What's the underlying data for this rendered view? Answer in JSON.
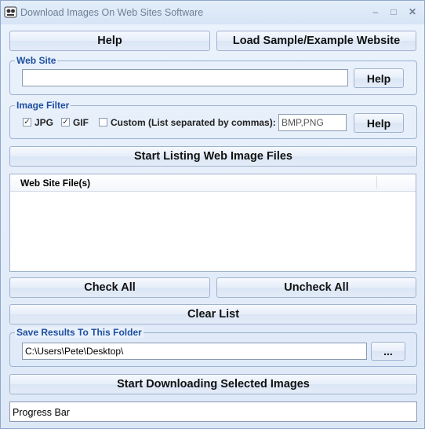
{
  "window": {
    "title": "Download Images On Web Sites Software",
    "controls": {
      "minimize": "–",
      "maximize": "□",
      "close": "✕"
    }
  },
  "buttons": {
    "help": "Help",
    "load_sample": "Load Sample/Example Website",
    "website_help": "Help",
    "filter_help": "Help",
    "start_listing": "Start Listing Web Image Files",
    "check_all": "Check All",
    "uncheck_all": "Uncheck All",
    "clear_list": "Clear List",
    "browse": "...",
    "start_download": "Start Downloading Selected Images"
  },
  "website": {
    "group_label": "Web Site",
    "value": ""
  },
  "image_filter": {
    "group_label": "Image Filter",
    "jpg": {
      "label": "JPG",
      "checked": true
    },
    "gif": {
      "label": "GIF",
      "checked": true
    },
    "custom": {
      "label": "Custom (List separated by commas):",
      "checked": false
    },
    "custom_value": "BMP,PNG"
  },
  "file_list": {
    "column_header": "Web Site File(s)",
    "rows": []
  },
  "save_folder": {
    "group_label": "Save Results To This Folder",
    "value": "C:\\Users\\Pete\\Desktop\\"
  },
  "progress": {
    "label": "Progress Bar"
  }
}
